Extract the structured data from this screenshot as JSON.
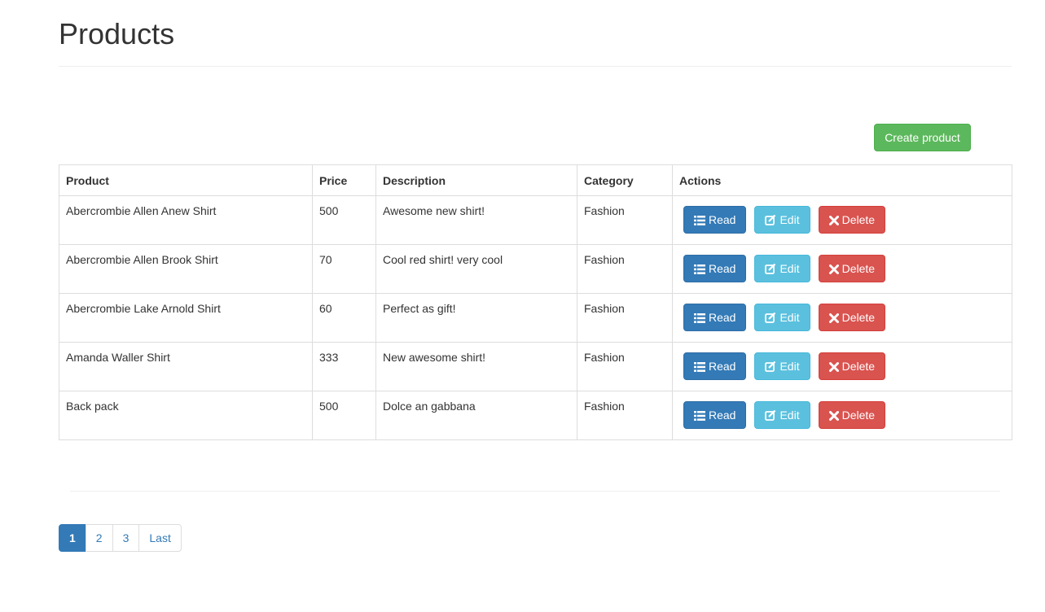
{
  "page": {
    "title": "Products"
  },
  "toolbar": {
    "create_label": "Create product"
  },
  "table": {
    "headers": {
      "product": "Product",
      "price": "Price",
      "description": "Description",
      "category": "Category",
      "actions": "Actions"
    },
    "rows": [
      {
        "product": "Abercrombie Allen Anew Shirt",
        "price": "500",
        "description": "Awesome new shirt!",
        "category": "Fashion"
      },
      {
        "product": "Abercrombie Allen Brook Shirt",
        "price": "70",
        "description": "Cool red shirt! very cool",
        "category": "Fashion"
      },
      {
        "product": "Abercrombie Lake Arnold Shirt",
        "price": "60",
        "description": "Perfect as gift!",
        "category": "Fashion"
      },
      {
        "product": "Amanda Waller Shirt",
        "price": "333",
        "description": "New awesome shirt!",
        "category": "Fashion"
      },
      {
        "product": "Back pack",
        "price": "500",
        "description": "Dolce an gabbana",
        "category": "Fashion"
      }
    ],
    "action_labels": {
      "read": "Read",
      "edit": "Edit",
      "delete": "Delete"
    },
    "action_icons": {
      "read": "list-icon",
      "edit": "edit-icon",
      "delete": "close-icon"
    }
  },
  "pagination": {
    "pages": [
      "1",
      "2",
      "3",
      "Last"
    ],
    "active": "1"
  },
  "colors": {
    "primary": "#337ab7",
    "success": "#5cb85c",
    "info": "#5bc0de",
    "danger": "#d9534f"
  }
}
